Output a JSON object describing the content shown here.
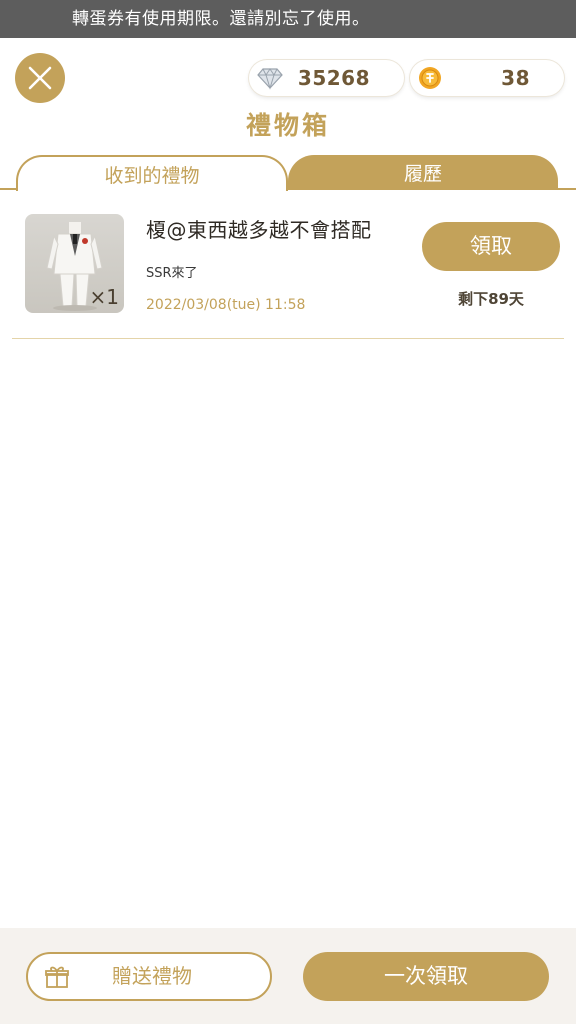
{
  "notice": {
    "text": "轉蛋券有使用期限。還請別忘了使用。"
  },
  "header": {
    "title": "禮物箱",
    "gems": {
      "icon": "diamond-icon",
      "value": "35268"
    },
    "coins": {
      "icon": "coin-icon",
      "value": "38"
    }
  },
  "tabs": [
    {
      "label": "收到的禮物",
      "active": true
    },
    {
      "label": "履歷",
      "active": false
    }
  ],
  "gifts": [
    {
      "sender": "榎@東西越多越不會搭配",
      "message": "SSR來了",
      "date": "2022/03/08(tue) 11:58",
      "quantity": "×1",
      "item_icon": "white-suit-icon",
      "claim_label": "領取",
      "remaining": "剩下89天"
    }
  ],
  "footer": {
    "send_label": "贈送禮物",
    "claim_all_label": "一次領取"
  },
  "colors": {
    "accent": "#c3a25a",
    "notice_bg": "#5d5d5d",
    "footer_bg": "#f5f2ee"
  }
}
